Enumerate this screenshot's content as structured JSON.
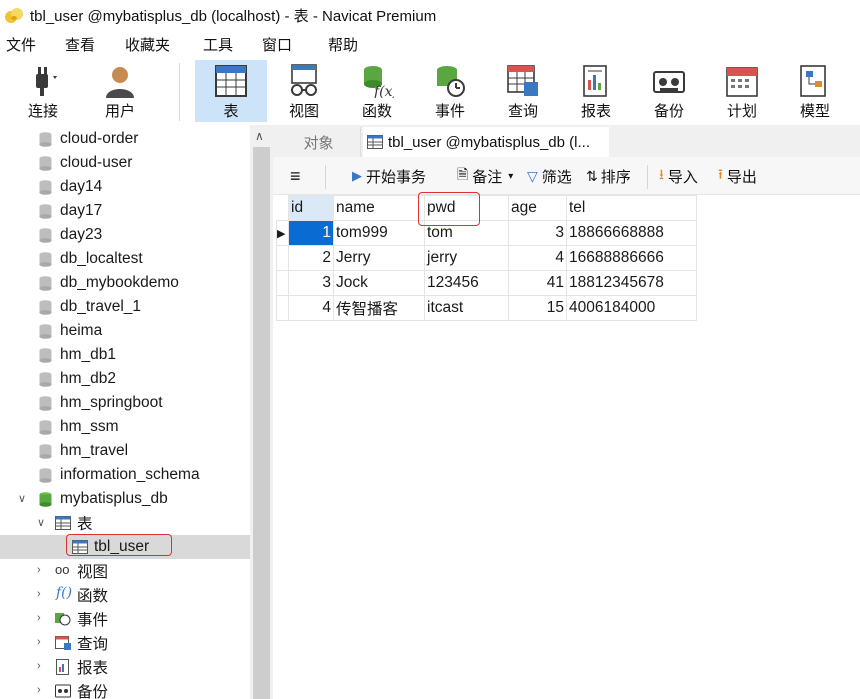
{
  "window": {
    "title": "tbl_user @mybatisplus_db (localhost) - 表 - Navicat Premium"
  },
  "menu": [
    "文件",
    "查看",
    "收藏夹",
    "工具",
    "窗口",
    "帮助"
  ],
  "toolbar": {
    "connect": "连接",
    "user": "用户",
    "table": "表",
    "view": "视图",
    "function": "函数",
    "event": "事件",
    "query": "查询",
    "report": "报表",
    "backup": "备份",
    "schedule": "计划",
    "model": "模型",
    "active": "表"
  },
  "tree": {
    "databases": [
      "cloud-order",
      "cloud-user",
      "day14",
      "day17",
      "day23",
      "db_localtest",
      "db_mybookdemo",
      "db_travel_1",
      "heima",
      "hm_db1",
      "hm_db2",
      "hm_springboot",
      "hm_ssm",
      "hm_travel",
      "information_schema"
    ],
    "open_db": "mybatisplus_db",
    "tables_group": "表",
    "selected_table": "tbl_user",
    "groups": [
      "视图",
      "函数",
      "事件",
      "查询",
      "报表",
      "备份"
    ]
  },
  "tabs": {
    "objects": "对象",
    "current": "tbl_user @mybatisplus_db (l..."
  },
  "subtoolbar": {
    "begin_transaction": "开始事务",
    "note": "备注",
    "filter": "筛选",
    "sort": "排序",
    "import": "导入",
    "export": "导出"
  },
  "grid": {
    "columns": [
      "id",
      "name",
      "pwd",
      "age",
      "tel"
    ],
    "rows": [
      [
        "1",
        "tom999",
        "tom",
        "3",
        "18866668888"
      ],
      [
        "2",
        "Jerry",
        "jerry",
        "4",
        "16688886666"
      ],
      [
        "3",
        "Jock",
        "123456",
        "41",
        "18812345678"
      ],
      [
        "4",
        "传智播客",
        "itcast",
        "15",
        "4006184000"
      ]
    ]
  },
  "colors": {
    "accent": "#0a6cd2",
    "selection": "#cde3f7",
    "annotation": "#e03131"
  }
}
